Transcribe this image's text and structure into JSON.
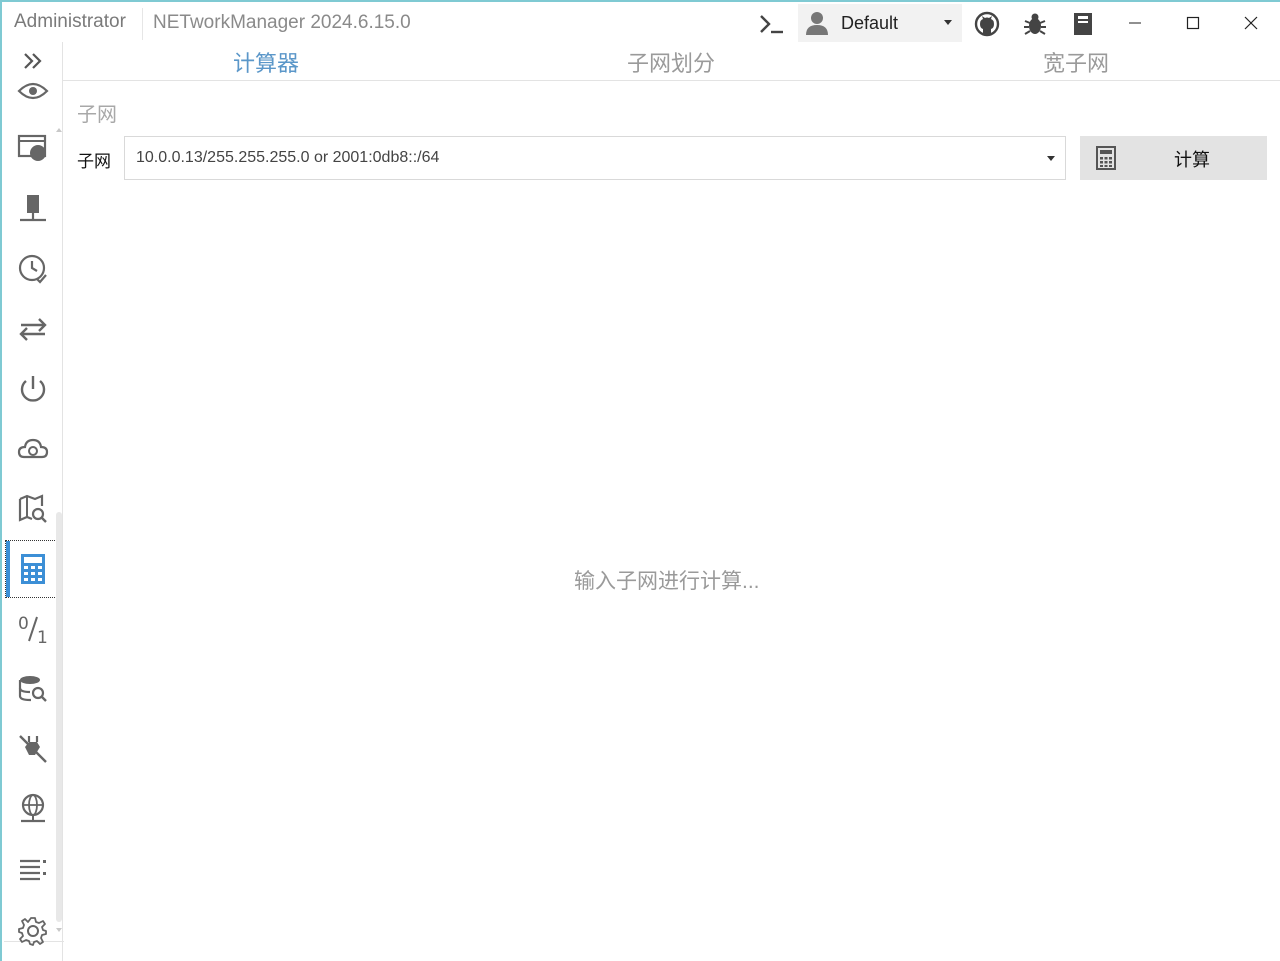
{
  "titlebar": {
    "role": "Administrator",
    "app_title": "NETworkManager 2024.6.15.0",
    "profile_name": "Default"
  },
  "icons": {
    "terminal": "terminal-icon",
    "profile": "user-icon",
    "github": "github-icon",
    "bug": "bug-icon",
    "docs": "book-icon",
    "minimize": "minimize-icon",
    "maximize": "maximize-icon",
    "close": "close-icon"
  },
  "sidebar": {
    "items": [
      {
        "icon": "expand-chevrons-icon"
      },
      {
        "icon": "eye-icon"
      },
      {
        "icon": "monitor-globe-icon"
      },
      {
        "icon": "server-network-icon"
      },
      {
        "icon": "clock-check-icon"
      },
      {
        "icon": "swap-arrows-icon"
      },
      {
        "icon": "power-icon"
      },
      {
        "icon": "cloud-search-icon"
      },
      {
        "icon": "map-search-icon"
      },
      {
        "icon": "calculator-icon",
        "active": true
      },
      {
        "icon": "bit-calculator-icon"
      },
      {
        "icon": "database-search-icon"
      },
      {
        "icon": "plug-disconnect-icon"
      },
      {
        "icon": "globe-network-icon"
      },
      {
        "icon": "list-icon"
      },
      {
        "icon": "settings-gear-icon"
      }
    ]
  },
  "tabs": [
    {
      "label": "计算器",
      "active": true
    },
    {
      "label": "子网划分",
      "active": false
    },
    {
      "label": "宽子网",
      "active": false
    }
  ],
  "main": {
    "section_title": "子网",
    "subnet_label": "子网",
    "subnet_placeholder": "10.0.0.13/255.255.255.0 or 2001:0db8::/64",
    "calculate_label": "计算",
    "empty_message": "输入子网进行计算..."
  },
  "colors": {
    "accent": "#5b97c9",
    "active_indicator": "#3c8fd6",
    "icon": "#555555",
    "button_bg": "#e3e3e3"
  }
}
